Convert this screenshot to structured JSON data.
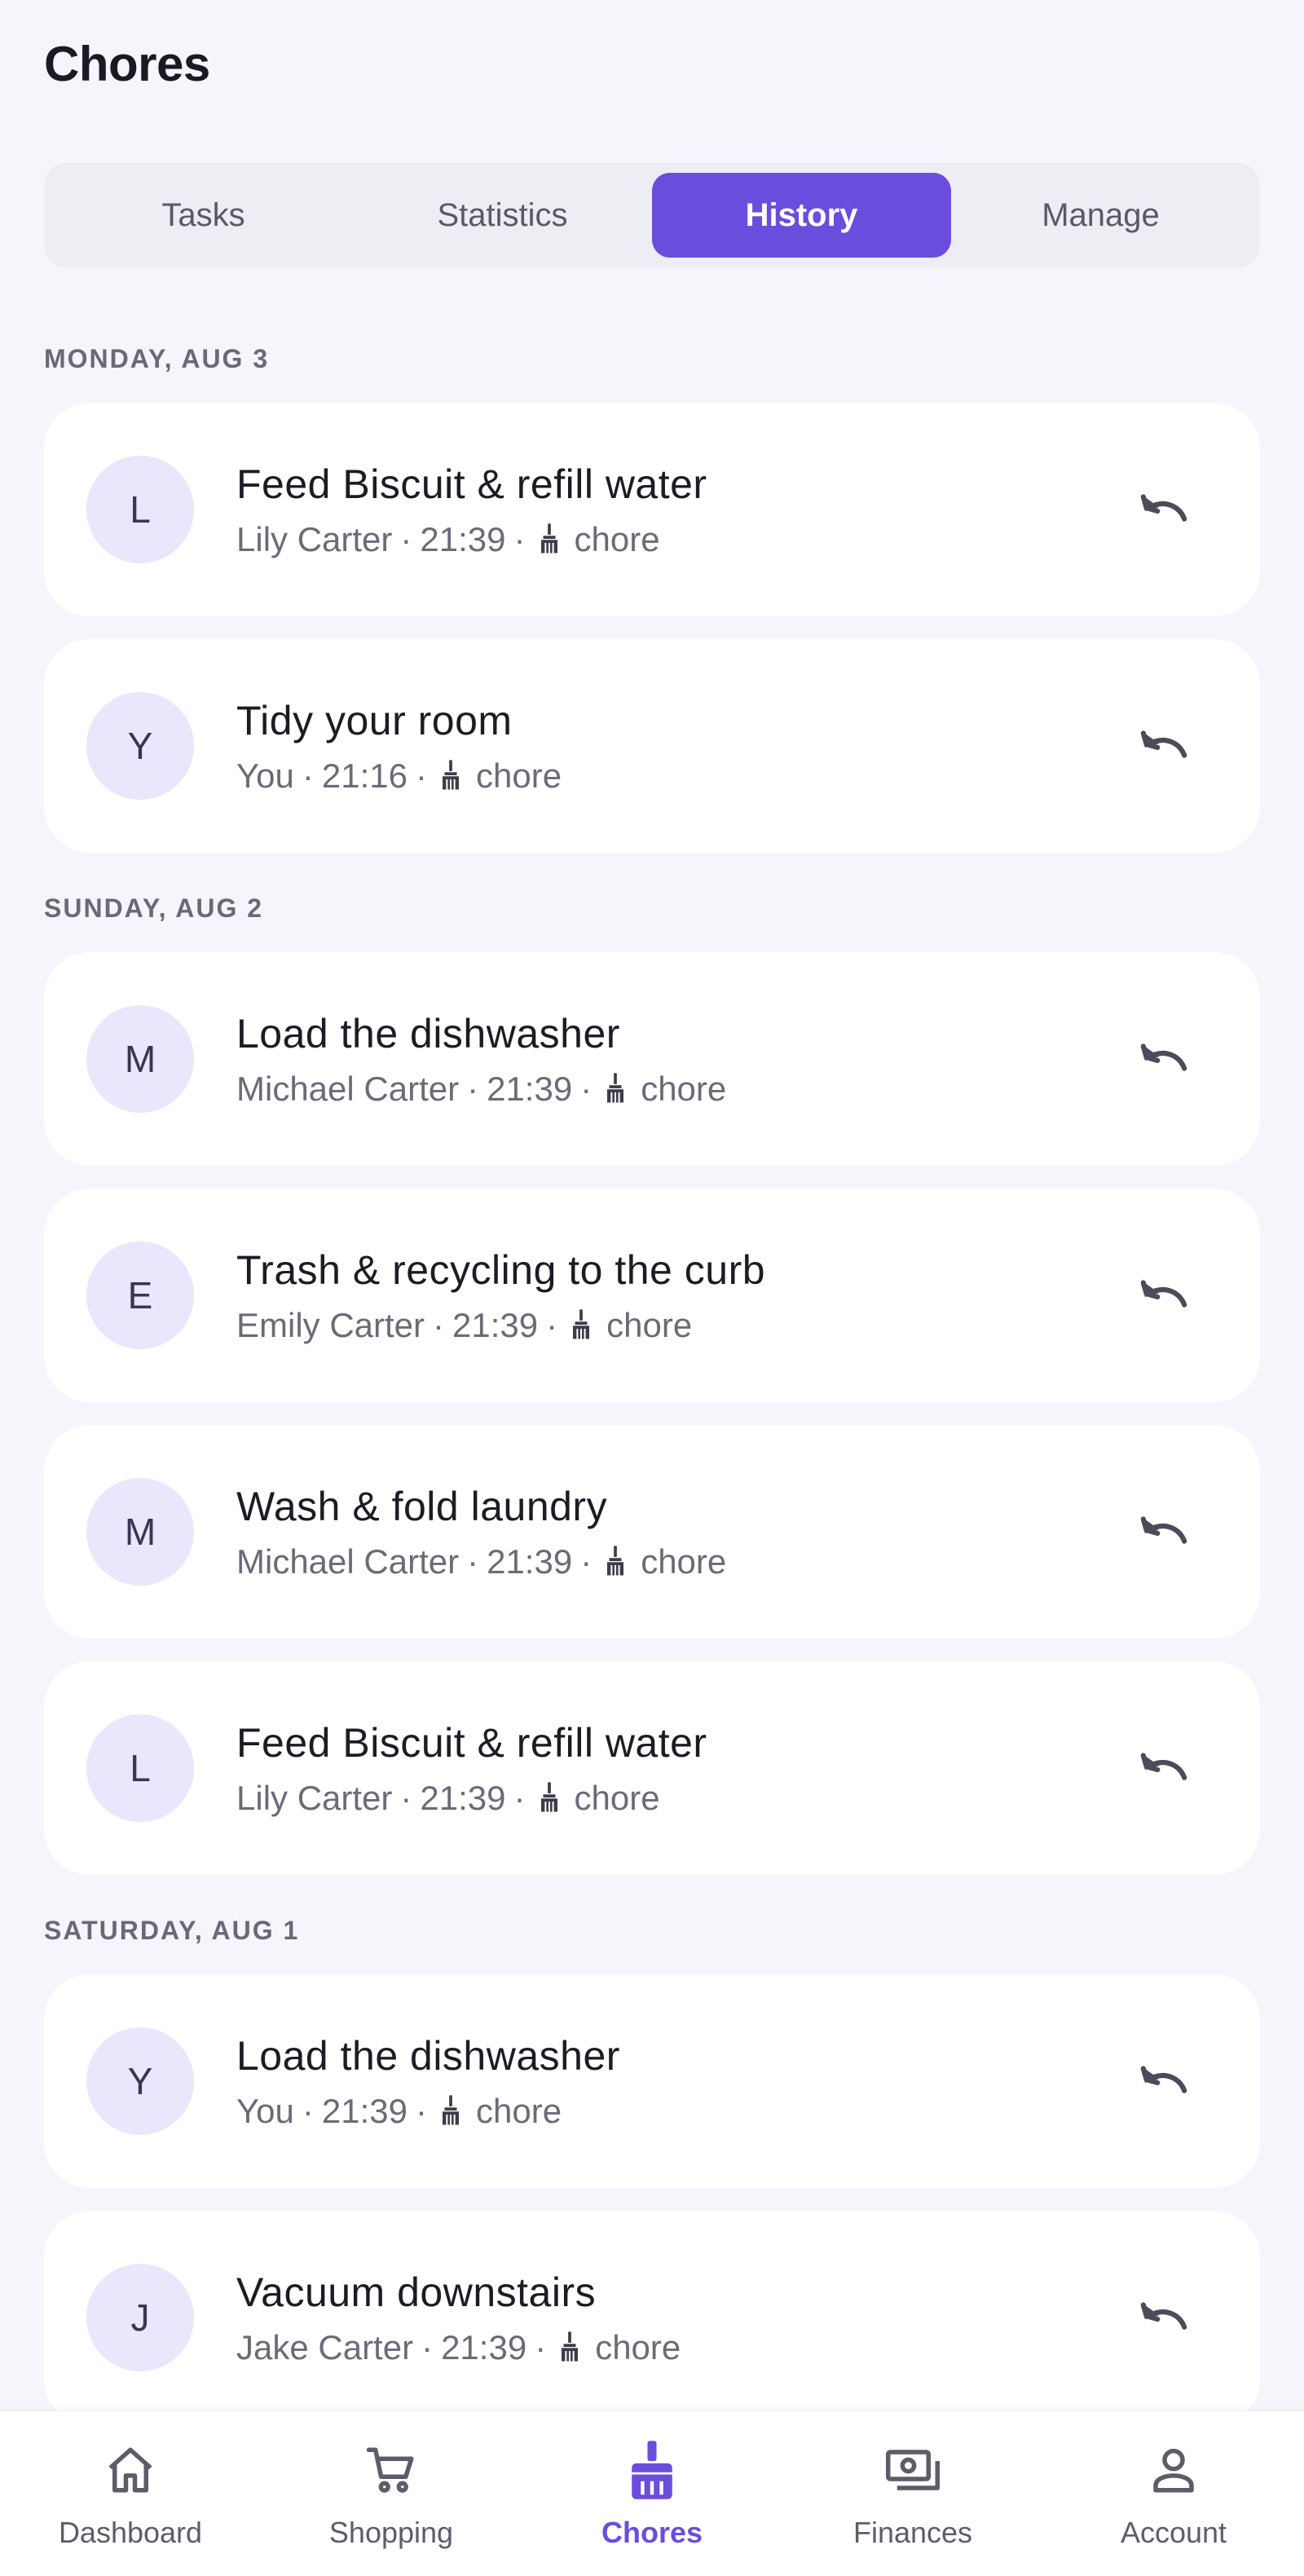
{
  "header": {
    "title": "Chores"
  },
  "tabs": [
    {
      "label": "Tasks",
      "active": false
    },
    {
      "label": "Statistics",
      "active": false
    },
    {
      "label": "History",
      "active": true
    },
    {
      "label": "Manage",
      "active": false
    }
  ],
  "sections": [
    {
      "date": "MONDAY, AUG 3",
      "entries": [
        {
          "initial": "L",
          "title": "Feed Biscuit & refill water",
          "person": "Lily Carter",
          "time": "21:39",
          "type": "chore"
        },
        {
          "initial": "Y",
          "title": "Tidy your room",
          "person": "You",
          "time": "21:16",
          "type": "chore"
        }
      ]
    },
    {
      "date": "SUNDAY, AUG 2",
      "entries": [
        {
          "initial": "M",
          "title": "Load the dishwasher",
          "person": "Michael Carter",
          "time": "21:39",
          "type": "chore"
        },
        {
          "initial": "E",
          "title": "Trash & recycling to the curb",
          "person": "Emily Carter",
          "time": "21:39",
          "type": "chore"
        },
        {
          "initial": "M",
          "title": "Wash & fold laundry",
          "person": "Michael Carter",
          "time": "21:39",
          "type": "chore"
        },
        {
          "initial": "L",
          "title": "Feed Biscuit & refill water",
          "person": "Lily Carter",
          "time": "21:39",
          "type": "chore"
        }
      ]
    },
    {
      "date": "SATURDAY, AUG 1",
      "entries": [
        {
          "initial": "Y",
          "title": "Load the dishwasher",
          "person": "You",
          "time": "21:39",
          "type": "chore"
        },
        {
          "initial": "J",
          "title": "Vacuum downstairs",
          "person": "Jake Carter",
          "time": "21:39",
          "type": "chore"
        }
      ]
    }
  ],
  "separator": "·",
  "icons": {
    "entry_type": "broom-icon",
    "action": "undo-icon"
  },
  "bottom_nav": [
    {
      "label": "Dashboard",
      "icon": "home-icon",
      "active": false
    },
    {
      "label": "Shopping",
      "icon": "cart-icon",
      "active": false
    },
    {
      "label": "Chores",
      "icon": "broom-icon",
      "active": true
    },
    {
      "label": "Finances",
      "icon": "cash-icon",
      "active": false
    },
    {
      "label": "Account",
      "icon": "person-icon",
      "active": false
    }
  ],
  "colors": {
    "accent": "#6a4ddd",
    "background": "#f6f5fb",
    "avatar_bg": "#ebe6fb",
    "muted_text": "#6d6a78"
  }
}
